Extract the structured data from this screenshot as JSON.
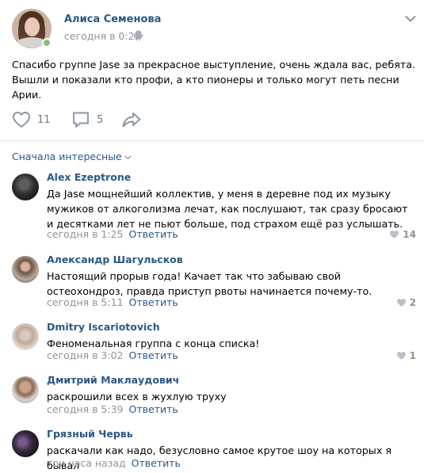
{
  "post": {
    "author": "Алиса Семенова",
    "date": "сегодня в 0:29",
    "text": "Спасибо группе Jase за прекрасное выступление, очень ждала вас, ребята. Вышли и показали кто профи, а кто пионеры и только могут петь песни Арии.",
    "likes": "11",
    "comments": "5",
    "icons": {
      "platform": "android-icon",
      "menu": "chevron-down-icon",
      "like": "heart-icon",
      "comment": "speech-bubble-icon",
      "share": "share-arrow-icon"
    }
  },
  "sort_label": "Сначала интересные",
  "comments": [
    {
      "name": "Alex Ezeptrone",
      "text": "Да Jase мощнейший коллектив, у меня в деревне под их музыку мужиков от алкоголизма лечат, как послушают, так сразу бросают и десятками лет не пьют больше, под страхом ещё раз услышать.",
      "date": "сегодня в 1:25",
      "reply": "Ответить",
      "likes": "14"
    },
    {
      "name": "Александр Шагульсков",
      "text": "Настоящий прорыв года! Качает так что забываю свой остеохондроз, правда приступ рвоты начинается почему-то.",
      "date": "сегодня в 5:11",
      "reply": "Ответить",
      "likes": "2"
    },
    {
      "name": "Dmitry Iscariotovich",
      "text": "Феноменальная группа с конца списка!",
      "date": "сегодня в 3:02",
      "reply": "Ответить",
      "likes": "1"
    },
    {
      "name": "Дмитрий Маклаудович",
      "text": "раскрошили всех в жухлую труху",
      "date": "сегодня в 5:39",
      "reply": "Ответить",
      "likes": ""
    },
    {
      "name": "Грязный Червь",
      "text": "раскачали как надо, безусловно самое крутое шоу на которых я бывал",
      "date": "три часа назад",
      "reply": "Ответить",
      "likes": ""
    }
  ],
  "colors": {
    "link": "#2a5885",
    "muted": "#939393",
    "icon": "#8a95a3",
    "online": "#8ac176",
    "divider": "#e7e8ec"
  }
}
